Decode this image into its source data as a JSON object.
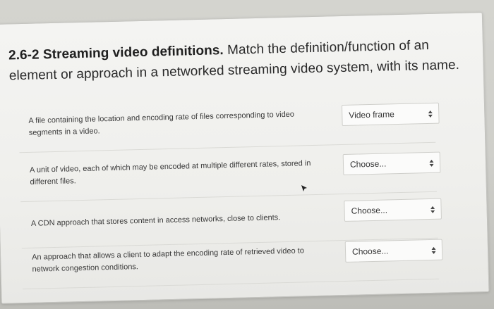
{
  "question": {
    "number": "2.6-2",
    "title": "Streaming video definitions.",
    "prompt": " Match the definition/function of an element or approach in a networked streaming video system, with its name."
  },
  "rows": [
    {
      "definition": "A file containing the location and encoding rate of files corresponding to video segments in a video.",
      "selected": "Video frame"
    },
    {
      "definition": "A unit of video, each of which may be encoded at multiple different rates, stored in different files.",
      "selected": "Choose..."
    },
    {
      "definition": "A CDN approach that stores content in access networks, close to clients.",
      "selected": "Choose..."
    },
    {
      "definition": "An approach that allows a client to adapt the encoding rate of retrieved video to network congestion conditions.",
      "selected": "Choose..."
    }
  ],
  "icons": {
    "dropdown": "chevron-updown-icon",
    "pointer": "mouse-pointer-icon"
  }
}
